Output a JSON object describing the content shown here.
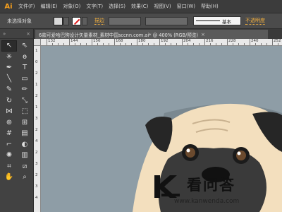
{
  "app": {
    "logo_text": "Ai"
  },
  "menu": [
    "文件(F)",
    "编辑(E)",
    "对象(O)",
    "文字(T)",
    "选择(S)",
    "效果(C)",
    "视图(V)",
    "窗口(W)",
    "帮助(H)"
  ],
  "control": {
    "selection_label": "未选择对象",
    "stroke_label": "描边",
    "stroke_style_label": "基本",
    "opacity_label": "不透明度"
  },
  "document": {
    "tab_title": "6款可爱哈巴狗设计矢量素材_素材中国sccnn.com.ai* @ 400% (RGB/预览)",
    "close_glyph": "×"
  },
  "ruler": {
    "h_labels": [
      "132",
      "144",
      "156",
      "168",
      "180",
      "192",
      "204",
      "216",
      "228",
      "240",
      "252"
    ],
    "v_labels": [
      "1",
      "0",
      "2",
      "1",
      "2",
      "1",
      "3",
      "2",
      "4",
      "2",
      "3",
      "2",
      "3",
      "4"
    ]
  },
  "colors": {
    "canvas_bg": "#8e9da6",
    "dog_face": "#f3dfbe",
    "dog_dark": "#262626",
    "accent": "#f7a01d"
  },
  "tools": [
    {
      "name": "selection-tool-icon",
      "glyph": "↖"
    },
    {
      "name": "direct-selection-tool-icon",
      "glyph": "⇖"
    },
    {
      "name": "magic-wand-tool-icon",
      "glyph": "✳"
    },
    {
      "name": "lasso-tool-icon",
      "glyph": "ɵ"
    },
    {
      "name": "pen-tool-icon",
      "glyph": "✒"
    },
    {
      "name": "type-tool-icon",
      "glyph": "T"
    },
    {
      "name": "line-tool-icon",
      "glyph": "╲"
    },
    {
      "name": "rectangle-tool-icon",
      "glyph": "▭"
    },
    {
      "name": "paintbrush-tool-icon",
      "glyph": "✎"
    },
    {
      "name": "pencil-tool-icon",
      "glyph": "✏"
    },
    {
      "name": "rotate-tool-icon",
      "glyph": "↻"
    },
    {
      "name": "scale-tool-icon",
      "glyph": "⤡"
    },
    {
      "name": "width-tool-icon",
      "glyph": "⋈"
    },
    {
      "name": "free-transform-tool-icon",
      "glyph": "⬚"
    },
    {
      "name": "shape-builder-tool-icon",
      "glyph": "⊕"
    },
    {
      "name": "perspective-grid-tool-icon",
      "glyph": "⊞"
    },
    {
      "name": "mesh-tool-icon",
      "glyph": "#"
    },
    {
      "name": "gradient-tool-icon",
      "glyph": "▤"
    },
    {
      "name": "eyedropper-tool-icon",
      "glyph": "⌐"
    },
    {
      "name": "blend-tool-icon",
      "glyph": "◐"
    },
    {
      "name": "symbol-sprayer-tool-icon",
      "glyph": "✺"
    },
    {
      "name": "column-graph-tool-icon",
      "glyph": "▥"
    },
    {
      "name": "artboard-tool-icon",
      "glyph": "⌗"
    },
    {
      "name": "slice-tool-icon",
      "glyph": "⧄"
    },
    {
      "name": "hand-tool-icon",
      "glyph": "✋"
    },
    {
      "name": "zoom-tool-icon",
      "glyph": "⌕"
    }
  ],
  "watermark": {
    "title": "看问答",
    "url": "www.kanwenda.com"
  }
}
